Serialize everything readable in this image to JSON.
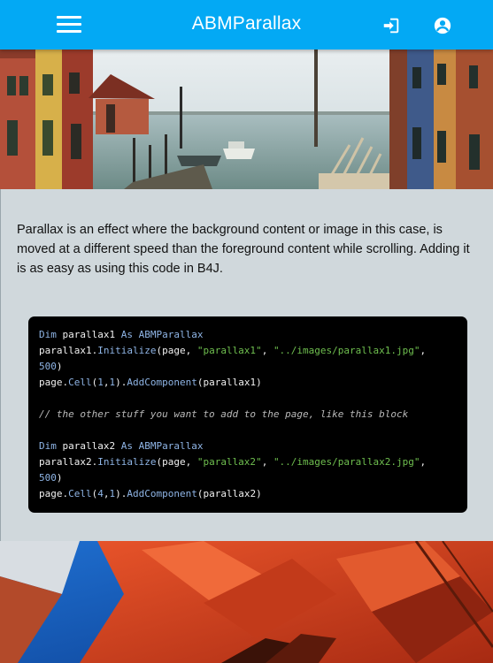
{
  "appbar": {
    "title": "ABMParallax",
    "menu_icon": "hamburger-menu-icon",
    "login_icon": "login-icon",
    "account_icon": "account-circle-icon",
    "color": "#03a9f4"
  },
  "intro": {
    "text": "Parallax is an effect where the background content or image in this case, is moved at a different speed than the foreground content while scrolling. Adding it is as easy as using this code in B4J."
  },
  "code": {
    "line1": {
      "kw1": "Dim",
      "t1": " parallax1 ",
      "kw2": "As",
      "t2": " ",
      "kw3": "ABMParallax"
    },
    "line2": {
      "t1": "parallax1.",
      "kw1": "Initialize",
      "t2": "(page, ",
      "s1": "\"parallax1\"",
      "t3": ", ",
      "s2": "\"../images/parallax1.jpg\"",
      "t4": ","
    },
    "line3": {
      "n1": "500",
      "t1": ")"
    },
    "line4": {
      "t1": "page.",
      "kw1": "Cell",
      "t2": "(",
      "n1": "1",
      "t3": ",",
      "n2": "1",
      "t4": ").",
      "kw2": "AddComponent",
      "t5": "(parallax1)"
    },
    "line6": {
      "c1": "// the other stuff you want to add to the page, like this block"
    },
    "line8": {
      "kw1": "Dim",
      "t1": " parallax2 ",
      "kw2": "As",
      "t2": " ",
      "kw3": "ABMParallax"
    },
    "line9": {
      "t1": "parallax2.",
      "kw1": "Initialize",
      "t2": "(page, ",
      "s1": "\"parallax2\"",
      "t3": ", ",
      "s2": "\"../images/parallax2.jpg\"",
      "t4": ","
    },
    "line10": {
      "n1": "500",
      "t1": ")"
    },
    "line11": {
      "t1": "page.",
      "kw1": "Cell",
      "t2": "(",
      "n1": "4",
      "t3": ",",
      "n2": "1",
      "t4": ").",
      "kw2": "AddComponent",
      "t5": "(parallax2)"
    }
  }
}
